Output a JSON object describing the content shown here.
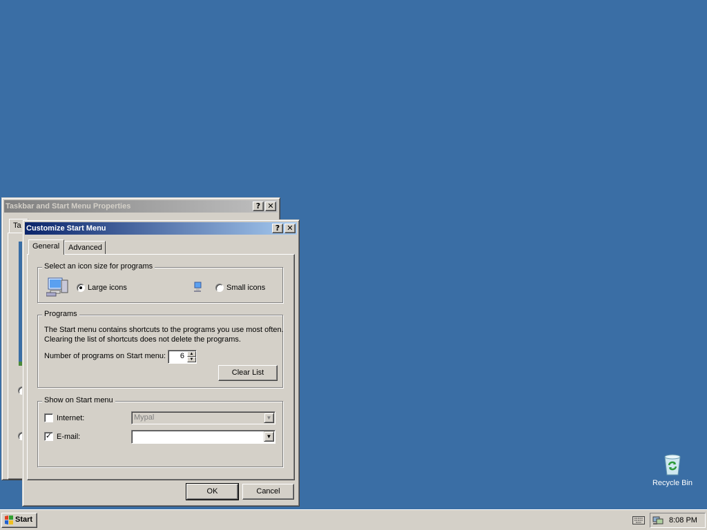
{
  "desktop": {
    "background": "#3a6ea5",
    "icons": [
      {
        "label": "Recycle Bin",
        "icon": "recycle-bin-icon"
      }
    ]
  },
  "bg_window": {
    "title": "Taskbar and Start Menu Properties",
    "help_label": "?",
    "close_label": "✕",
    "tab_partial": "Ta"
  },
  "dialog": {
    "title": "Customize Start Menu",
    "help_label": "?",
    "close_label": "✕",
    "tabs": [
      {
        "label": "General",
        "selected": true
      },
      {
        "label": "Advanced",
        "selected": false
      }
    ],
    "icon_size": {
      "group_title": "Select an icon size for programs",
      "large_label": "Large icons",
      "small_label": "Small icons",
      "selected": "large"
    },
    "programs": {
      "group_title": "Programs",
      "line1": "The Start menu contains shortcuts to the programs you use most often.",
      "line2": "Clearing the list of shortcuts does not delete the programs.",
      "count_label": "Number of programs on Start menu:",
      "count_value": "6",
      "clear_label": "Clear List"
    },
    "show_on_start": {
      "group_title": "Show on Start menu",
      "internet_label": "Internet:",
      "internet_checked": false,
      "internet_value": "Mypal",
      "email_label": "E-mail:",
      "email_checked": true,
      "email_value": ""
    },
    "ok_label": "OK",
    "cancel_label": "Cancel"
  },
  "taskbar": {
    "start_label": "Start",
    "clock": "8:08 PM",
    "tray_icons": [
      "keyboard-icon",
      "network-icon"
    ]
  }
}
